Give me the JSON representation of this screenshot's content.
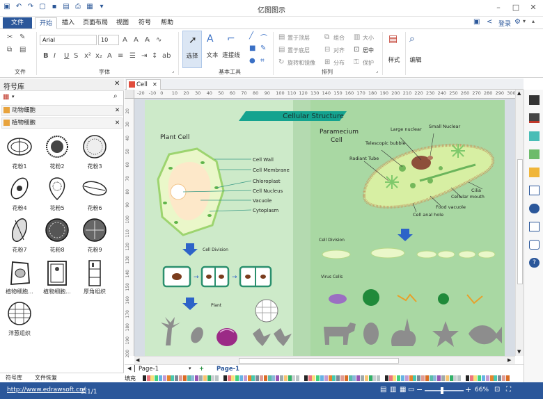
{
  "app": {
    "title": "亿图图示"
  },
  "quick_access": [
    "logo",
    "undo",
    "redo",
    "new",
    "save",
    "open",
    "print",
    "export",
    "more"
  ],
  "menu": {
    "file": "文件",
    "tabs": [
      "开始",
      "插入",
      "页面布局",
      "视图",
      "符号",
      "帮助"
    ],
    "right": {
      "login": "登录"
    }
  },
  "ribbon": {
    "groups": {
      "file": "文件",
      "font": "字体",
      "basic_tools": "基本工具",
      "arrange": "排列"
    },
    "font_name": "Arial",
    "font_size": "10",
    "tools": {
      "select": "选择",
      "text": "文本",
      "connector": "连接线",
      "style": "样式",
      "edit": "编辑"
    },
    "arrange": {
      "bring_front": "置于顶层",
      "send_back": "置于底层",
      "rotate": "旋转和镜像",
      "group": "组合",
      "align": "对齐",
      "distribute": "分布",
      "size": "大小",
      "center": "居中",
      "protect": "保护"
    }
  },
  "library": {
    "title": "符号库",
    "categories": [
      "动物细胞",
      "植物细胞"
    ],
    "shapes": [
      "花粉1",
      "花粉2",
      "花粉3",
      "花粉4",
      "花粉5",
      "花粉6",
      "花粉7",
      "花粉8",
      "花粉9",
      "植物细胞...",
      "植物细胞...",
      "厚角组织",
      "洋葱组织"
    ],
    "bottom_tabs": [
      "符号库",
      "文件恢复"
    ]
  },
  "document": {
    "tab": "Cell"
  },
  "ruler": {
    "h_ticks": [
      "-20",
      "-10",
      "0",
      "10",
      "20",
      "30",
      "40",
      "50",
      "60",
      "70",
      "80",
      "90",
      "100",
      "110",
      "120",
      "130",
      "140",
      "150",
      "160",
      "170",
      "180",
      "190",
      "200",
      "210",
      "220",
      "230",
      "240",
      "250",
      "260",
      "270",
      "280",
      "290",
      "300"
    ],
    "v_ticks": [
      "20",
      "30",
      "40",
      "50",
      "60",
      "70",
      "80",
      "90",
      "100",
      "110",
      "120",
      "130",
      "140",
      "150",
      "160",
      "170",
      "180",
      "190",
      "200"
    ]
  },
  "diagram": {
    "title": "Cellular Structure",
    "plant_cell": "Plant Cell",
    "plant_labels": [
      "Cell Wall",
      "Cell Membrane",
      "Chloroplast",
      "Cell Nucleus",
      "Vacuole",
      "Cytoplasm"
    ],
    "cell_division": "Cell Division",
    "plant": "Plant",
    "paramecium": "Paramecium\nCell",
    "paramecium_labels": [
      "Small Nuclear",
      "Large nuclear",
      "Telescopic bubble",
      "Radiant Tube",
      "Cilia",
      "Cellular mouth",
      "Food vacuole",
      "Cell anal hole"
    ],
    "cell_division_right": "Cell Division",
    "virus_cells": "Virus Cells"
  },
  "pagebar": {
    "page_select": "Page-1",
    "page_tab": "Page-1"
  },
  "colorbar": {
    "label": "填充"
  },
  "status": {
    "url": "http://www.edrawsoft.cn/",
    "page": "页1/1",
    "zoom": "66%"
  }
}
